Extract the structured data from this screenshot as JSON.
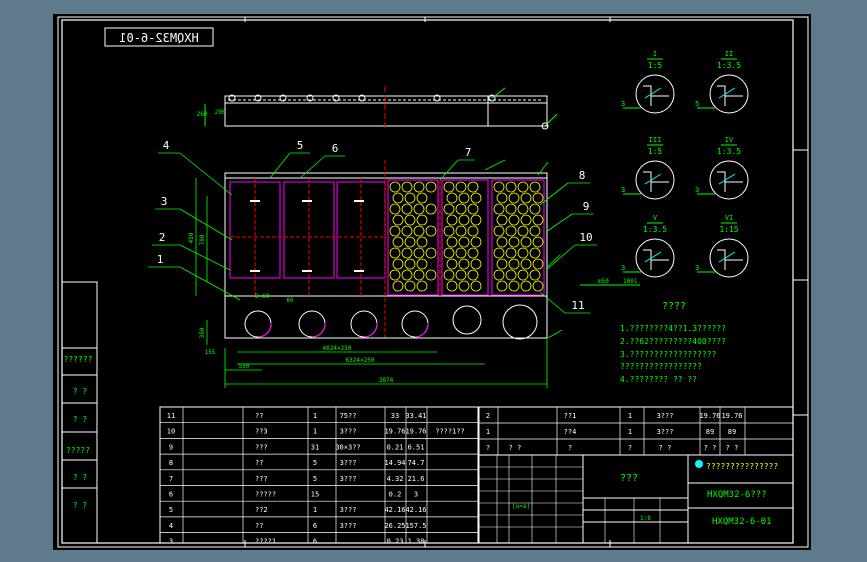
{
  "drawing_number_mirrored": "HXQM32-6-01",
  "callouts": [
    "1",
    "2",
    "3",
    "4",
    "5",
    "6",
    "7",
    "8",
    "9",
    "10",
    "11"
  ],
  "dims": {
    "d260": "260",
    "d200": "200",
    "d450": "450",
    "d780": "780",
    "d2": "2",
    "d8x60": "8 60",
    "d60": "60",
    "d350": "350",
    "d_left": "1×250",
    "d_mid1": "4624×250",
    "d_mid2": "6324×250",
    "d_bottom": "3874",
    "d_low": "550",
    "d_3": "3",
    "d_4": "4",
    "d_155": "155"
  },
  "details": [
    {
      "roman": "I",
      "scale": "1:5",
      "side": "3"
    },
    {
      "roman": "II",
      "scale": "1:3.5",
      "side": "5"
    },
    {
      "roman": "III",
      "scale": "1:5",
      "side": "3"
    },
    {
      "roman": "IV",
      "scale": "1:3.5",
      "side": "3"
    },
    {
      "roman": "V",
      "scale": "1:3.5",
      "side": "3"
    },
    {
      "roman": "VI",
      "scale": "1:15",
      "side": "3"
    }
  ],
  "detail_annots": [
    "m50",
    "1001"
  ],
  "notes": {
    "title": "????",
    "lines": [
      "1.????????4??1.3??????",
      "2.??62?????????400????",
      "3.??????????????????",
      "   ?????????????????",
      "4.???????? ?? ??"
    ]
  },
  "left_column": [
    "??????",
    "? ?",
    "? ?",
    "?????",
    "? ?",
    "? ?"
  ],
  "bom_left": [
    [
      "11",
      "??",
      "1",
      "75??",
      "33",
      "33.41"
    ],
    [
      "10",
      "??3",
      "1",
      "3???",
      "19.76",
      "19.76",
      "????1??"
    ],
    [
      "9",
      "???",
      "31",
      "30×3??",
      "0.21",
      "6.51"
    ],
    [
      "8",
      "??",
      "5",
      "3???",
      "14.94",
      "74.7"
    ],
    [
      "7",
      "???",
      "5",
      "3???",
      "4.32",
      "21.6"
    ],
    [
      "6",
      "?????",
      "15",
      "",
      "0.2",
      "3"
    ],
    [
      "5",
      "??2",
      "1",
      "3???",
      "42.16",
      "42.16"
    ],
    [
      "4",
      "??",
      "6",
      "3???",
      "26.25",
      "157.5"
    ],
    [
      "3",
      "????1",
      "6",
      "",
      "0.23",
      "1.38"
    ]
  ],
  "bom_right": [
    [
      "2",
      "",
      "??1",
      "1",
      "3???",
      "19.76",
      "19.76"
    ],
    [
      "1",
      "",
      "??4",
      "1",
      "3???",
      "89",
      "89"
    ],
    [
      "?",
      "? ?",
      "?",
      "?",
      "? ?",
      "? ?",
      "? ?"
    ]
  ],
  "title_block": {
    "company": "???????????????",
    "part_name": "???",
    "assembly": "HXQM32-6???",
    "drawing_no": "HXQM32-6-01",
    "scale": "1:8",
    "sheet": "1:8 1:8",
    "wt": "[u=a]"
  },
  "colors": {
    "bg": "#000000",
    "line": "#ffffff",
    "text": "#00ff00",
    "dim": "#00ff00",
    "magenta": "#ff00ff",
    "red": "#ff0000",
    "yellow": "#ffff00",
    "cyan": "#00ffff"
  }
}
